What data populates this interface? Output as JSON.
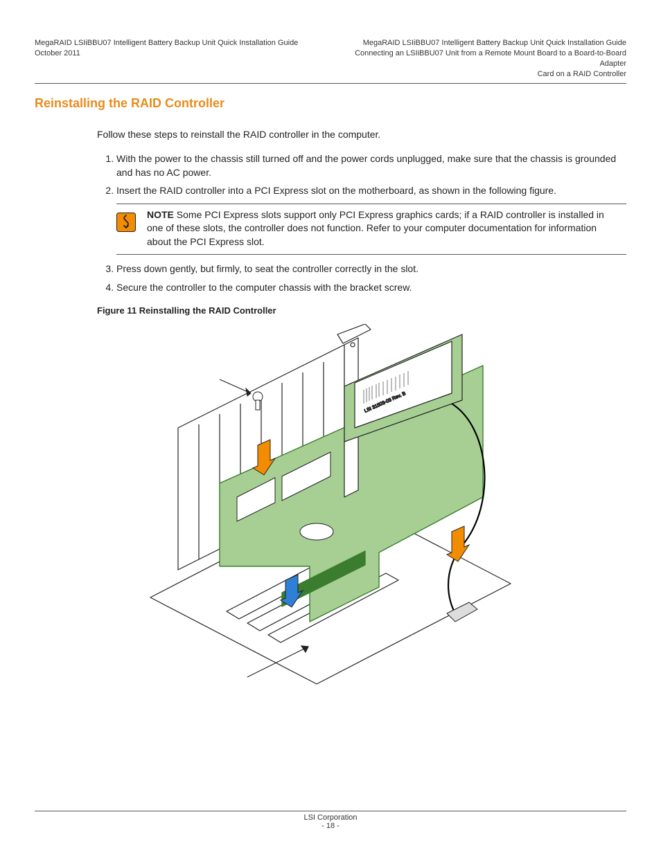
{
  "header": {
    "left_line1": "MegaRAID LSIiBBU07 Intelligent Battery Backup Unit Quick Installation Guide",
    "left_line2": "October 2011",
    "right_line1": "MegaRAID LSIiBBU07 Intelligent Battery Backup Unit Quick Installation Guide",
    "right_line2": "Connecting an LSIiBBU07 Unit from a Remote Mount Board to a Board-to-Board Adapter",
    "right_line3": "Card on a RAID Controller"
  },
  "section": {
    "title": "Reinstalling the RAID Controller",
    "intro": "Follow these steps to reinstall the RAID controller in the computer."
  },
  "steps": {
    "s1": "With the power to the chassis still turned off and the power cords unplugged, make sure that the chassis is grounded and has no AC power.",
    "s2": "Insert the RAID controller into a PCI Express slot on the motherboard, as shown in the following figure.",
    "s3": "Press down gently, but firmly, to seat the controller correctly in the slot.",
    "s4": "Secure the controller to the computer chassis with the bracket screw."
  },
  "note": {
    "label": "NOTE",
    "text": " Some PCI Express slots support only PCI Express graphics cards; if a RAID controller is installed in one of these slots, the controller does not function. Refer to your computer documentation for information about the PCI Express slot."
  },
  "figure": {
    "caption": "Figure 11  Reinstalling the RAID Controller",
    "module_label": "LSI 31503-03 Rev. B"
  },
  "footer": {
    "company": "LSI Corporation",
    "page": "- 18 -"
  },
  "colors": {
    "accent": "#e88b1a",
    "board_green": "#a7cf94",
    "board_edge": "#3a7d2f",
    "arrow_dark": "#f28c00",
    "arrow_blue": "#2f7fd6"
  }
}
